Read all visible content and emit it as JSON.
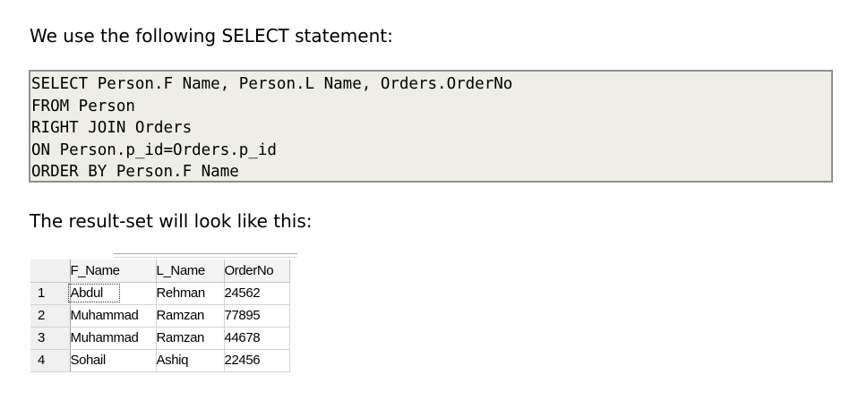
{
  "intro_text": "We use the following SELECT statement:",
  "code": {
    "lines": [
      "SELECT Person.F Name, Person.L Name, Orders.OrderNo",
      "FROM Person",
      "RIGHT JOIN Orders",
      "ON Person.p_id=Orders.p_id",
      "ORDER BY Person.F Name"
    ]
  },
  "result_text": "The result-set will look like this:",
  "result_grid": {
    "columns": [
      "F_Name",
      "L_Name",
      "OrderNo"
    ],
    "rows": [
      {
        "num": "1",
        "cells": [
          "Abdul",
          "Rehman",
          "24562"
        ]
      },
      {
        "num": "2",
        "cells": [
          "Muhammad",
          "Ramzan",
          "77895"
        ]
      },
      {
        "num": "3",
        "cells": [
          "Muhammad",
          "Ramzan",
          "44678"
        ]
      },
      {
        "num": "4",
        "cells": [
          "Sohail",
          "Ashiq",
          "22456"
        ]
      }
    ]
  },
  "colors": {
    "code_background": "#eeeee6",
    "code_border": "#8f8f8f"
  }
}
